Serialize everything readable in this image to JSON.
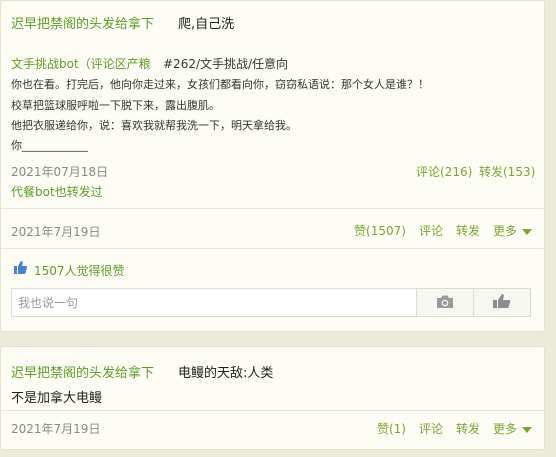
{
  "post1": {
    "author": "迟早把禁阁的头发给拿下",
    "text": "爬,自己洗",
    "repost": {
      "source_user": "文手挑战bot（评论区产粮",
      "tags": "#262/文手挑战/任意向",
      "lines": [
        "你也在看。打完后，他向你走过来，女孩们都看向你，窃窃私语说：那个女人是谁？！",
        "校草把篮球服呼啦一下脱下来，露出腹肌。",
        "他把衣服递给你，说：喜欢我就帮我洗一下，明天拿给我。",
        "你____________"
      ],
      "date": "2021年07月18日",
      "via": "代餐bot也转发过",
      "comment_label": "评论(216)",
      "forward_label": "转发(153)"
    },
    "date": "2021年7月19日",
    "like_label": "赞(1507)",
    "comment_label": "评论",
    "forward_label": "转发",
    "more_label": "更多",
    "likes_summary": "1507人觉得很赞",
    "reply_placeholder": "我也说一句"
  },
  "post2": {
    "author": "迟早把禁阁的头发给拿下",
    "text": "电鳗的天敌:人类",
    "body": "不是加拿大电鳗",
    "date": "2021年7月19日",
    "like_label": "赞(1)",
    "comment_label": "评论",
    "forward_label": "转发",
    "more_label": "更多"
  },
  "colors": {
    "accent_green": "#5e9b29",
    "link_green": "#7aa531",
    "page_bg": "#ecebd9",
    "card_bg": "#fdfdf6",
    "thumb_blue": "#4a7fd6"
  },
  "icons": [
    "thumbs-up-icon",
    "camera-icon",
    "like-hand-icon",
    "chevron-down-icon"
  ]
}
